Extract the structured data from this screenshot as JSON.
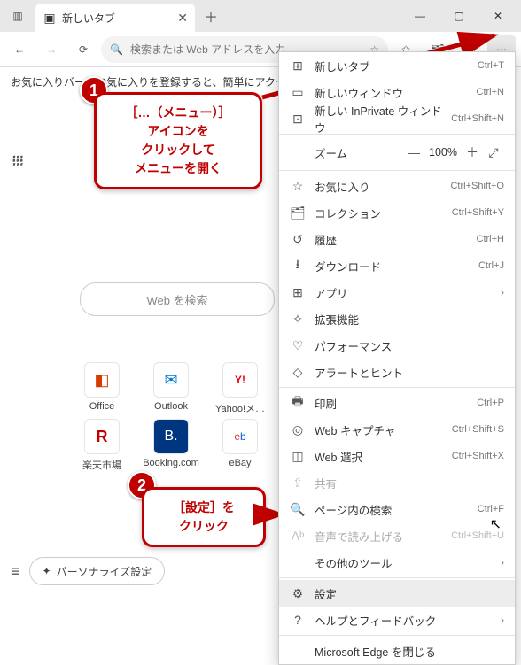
{
  "titlebar": {
    "tab": {
      "title": "新しいタブ"
    },
    "win": {
      "min": "—",
      "max": "▢",
      "close": "✕"
    }
  },
  "toolbar": {
    "address_placeholder": "検索または Web アドレスを入力"
  },
  "infobar": {
    "text": "お気に入りバーにお気に入りを登録すると、簡単にアクセスできるようになります"
  },
  "search": {
    "placeholder": "Web を検索"
  },
  "quicklinks": [
    {
      "label": "Office",
      "icon": "O"
    },
    {
      "label": "Outlook",
      "icon": "✉"
    },
    {
      "label": "Yahoo!メ…",
      "icon": "Y!"
    },
    {
      "label": "楽天市場",
      "icon": "R"
    },
    {
      "label": "Booking.com",
      "icon": "B."
    },
    {
      "label": "eBay",
      "icon": "e"
    }
  ],
  "bottom": {
    "personalize": "パーソナライズ設定"
  },
  "callouts": {
    "c1_l1": "［…（メニュー）］",
    "c1_l2": "アイコンを",
    "c1_l3": "クリックして",
    "c1_l4": "メニューを開く",
    "c2_l1": "［設定］を",
    "c2_l2": "クリック",
    "n1": "1",
    "n2": "2"
  },
  "menu": {
    "items": [
      {
        "icon": "⊞",
        "label": "新しいタブ",
        "shortcut": "Ctrl+T"
      },
      {
        "icon": "▭",
        "label": "新しいウィンドウ",
        "shortcut": "Ctrl+N"
      },
      {
        "icon": "⊡",
        "label": "新しい InPrivate ウィンドウ",
        "shortcut": "Ctrl+Shift+N"
      }
    ],
    "zoom": {
      "label": "ズーム",
      "minus": "—",
      "value": "100%",
      "plus": "＋",
      "full": "⤢"
    },
    "items2": [
      {
        "icon": "☆",
        "label": "お気に入り",
        "shortcut": "Ctrl+Shift+O"
      },
      {
        "icon": "🗂",
        "label": "コレクション",
        "shortcut": "Ctrl+Shift+Y"
      },
      {
        "icon": "↺",
        "label": "履歴",
        "shortcut": "Ctrl+H"
      },
      {
        "icon": "⭳",
        "label": "ダウンロード",
        "shortcut": "Ctrl+J"
      },
      {
        "icon": "⊞",
        "label": "アプリ",
        "shortcut": "",
        "arrow": true
      },
      {
        "icon": "✧",
        "label": "拡張機能",
        "shortcut": ""
      },
      {
        "icon": "♡",
        "label": "パフォーマンス",
        "shortcut": ""
      },
      {
        "icon": "◇",
        "label": "アラートとヒント",
        "shortcut": ""
      }
    ],
    "items3": [
      {
        "icon": "🖶",
        "label": "印刷",
        "shortcut": "Ctrl+P"
      },
      {
        "icon": "◎",
        "label": "Web キャプチャ",
        "shortcut": "Ctrl+Shift+S"
      },
      {
        "icon": "◫",
        "label": "Web 選択",
        "shortcut": "Ctrl+Shift+X"
      },
      {
        "icon": "⇪",
        "label": "共有",
        "shortcut": "",
        "disabled": true
      },
      {
        "icon": "🔍",
        "label": "ページ内の検索",
        "shortcut": "Ctrl+F"
      },
      {
        "icon": "Aᵇ",
        "label": "音声で読み上げる",
        "shortcut": "Ctrl+Shift+U",
        "disabled": true
      },
      {
        "icon": "",
        "label": "その他のツール",
        "shortcut": "",
        "arrow": true
      }
    ],
    "items4": [
      {
        "icon": "⚙",
        "label": "設定",
        "shortcut": "",
        "hover": true
      },
      {
        "icon": "?",
        "label": "ヘルプとフィードバック",
        "shortcut": "",
        "arrow": true
      }
    ],
    "close": {
      "label": "Microsoft Edge を閉じる"
    }
  }
}
